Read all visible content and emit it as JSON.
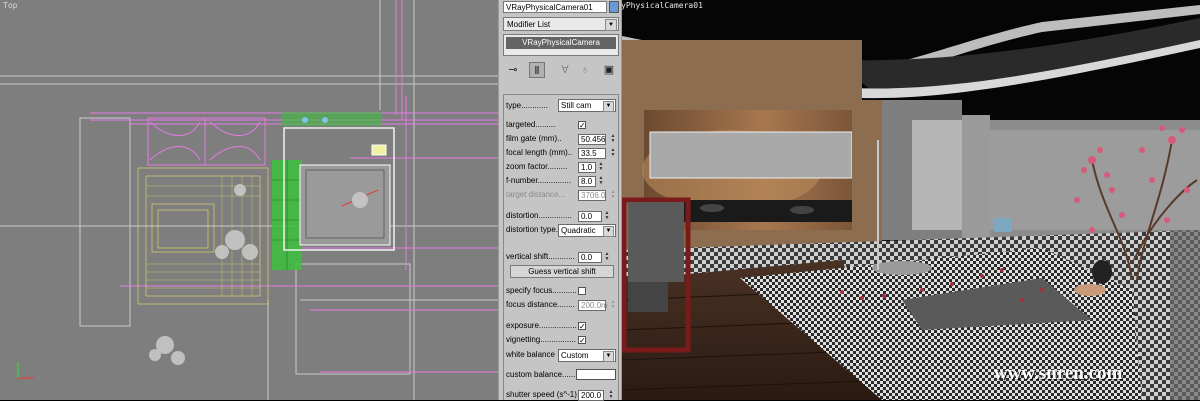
{
  "viewport_top": {
    "label": "Top"
  },
  "viewport_perspective": {
    "label": "yPhysicalCamera01"
  },
  "panel": {
    "object_name": "VRayPhysicalCamera01",
    "modifier_list": "Modifier List",
    "stack_item": "VRayPhysicalCamera",
    "params": {
      "type_label": "type",
      "type_value": "Still cam",
      "targeted_label": "targeted",
      "targeted_checked": "✓",
      "film_gate_label": "film gate (mm)",
      "film_gate_value": "50.456",
      "focal_length_label": "focal length (mm)",
      "focal_length_value": "33.5",
      "zoom_factor_label": "zoom factor",
      "zoom_factor_value": "1.0",
      "f_number_label": "f-number",
      "f_number_value": "8.0",
      "target_distance_label": "target distance",
      "target_distance_value": "3706.0",
      "distortion_label": "distortion",
      "distortion_value": "0.0",
      "distortion_type_label": "distortion type",
      "distortion_type_value": "Quadratic",
      "vertical_shift_label": "vertical shift",
      "vertical_shift_value": "0.0",
      "guess_vertical_shift": "Guess vertical shift",
      "specify_focus_label": "specify focus",
      "focus_distance_label": "focus distance",
      "focus_distance_value": "200.0m",
      "exposure_label": "exposure",
      "exposure_checked": "✓",
      "vignetting_label": "vignetting",
      "vignetting_checked": "✓",
      "white_balance_label": "white balance",
      "white_balance_value": "Custom",
      "custom_balance_label": "custom balance",
      "shutter_speed_label": "shutter speed (s^-1)",
      "shutter_speed_value": "200.0"
    },
    "tool_icons": [
      "pin-stack-icon",
      "show-end-result-icon",
      "make-unique-icon",
      "remove-modifier-icon",
      "configure-sets-icon"
    ]
  },
  "watermark": "www.snren.com",
  "colors": {
    "viewport_gray": "#7e7e7e",
    "wire_magenta": "#e47be4",
    "wire_yellow": "#e8e36a",
    "wire_green": "#3cbf3c",
    "panel_gray": "#c5c5c5"
  }
}
